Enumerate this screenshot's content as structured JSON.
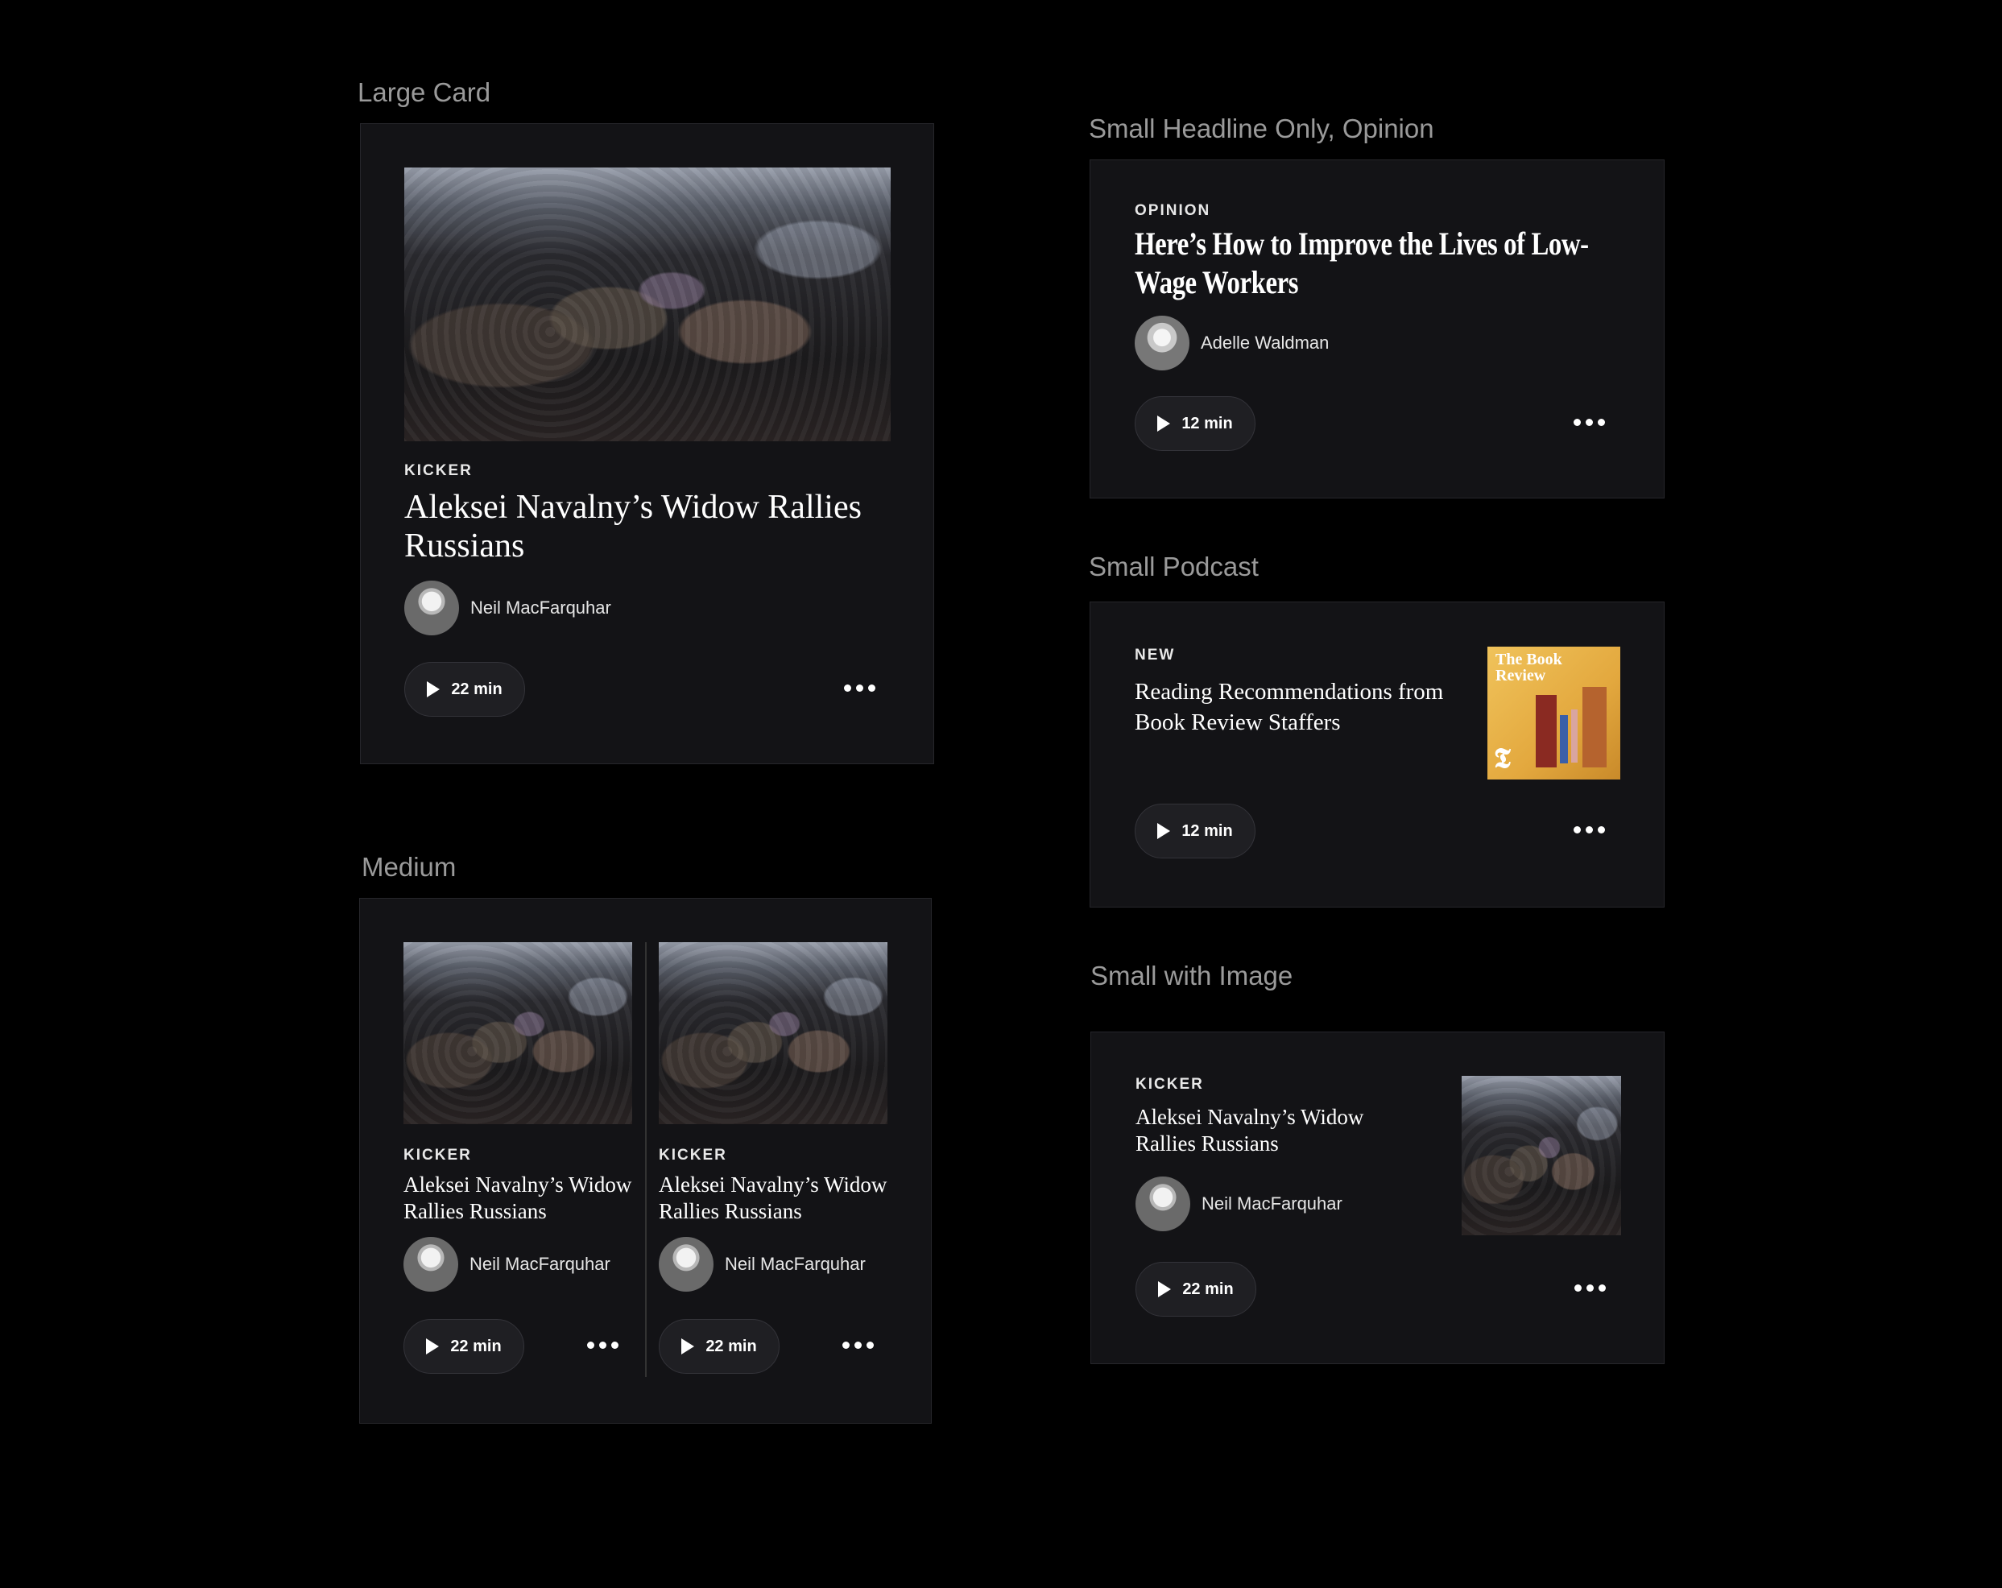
{
  "labels": {
    "large": "Large Card",
    "medium": "Medium",
    "small_headline": "Small Headline Only, Opinion",
    "small_podcast": "Small Podcast",
    "small_image": "Small with Image"
  },
  "large_card": {
    "kicker": "KICKER",
    "headline": "Aleksei Navalny’s Widow Rallies Russians",
    "author": "Neil MacFarquhar",
    "duration": "22 min"
  },
  "medium_cards": [
    {
      "kicker": "KICKER",
      "headline": "Aleksei Navalny’s Widow Rallies Russians",
      "author": "Neil MacFarquhar",
      "duration": "22 min"
    },
    {
      "kicker": "KICKER",
      "headline": "Aleksei Navalny’s Widow Rallies Russians",
      "author": "Neil MacFarquhar",
      "duration": "22 min"
    }
  ],
  "opinion_card": {
    "kicker": "OPINION",
    "headline": "Here’s How to Improve the Lives of Low-Wage Workers",
    "author": "Adelle Waldman",
    "duration": "12 min"
  },
  "podcast_card": {
    "kicker": "NEW",
    "headline": "Reading Recommendations from Book Review Staffers",
    "art_title": "The Book Review",
    "duration": "12 min"
  },
  "image_card": {
    "kicker": "KICKER",
    "headline": "Aleksei Navalny’s Widow Rallies Russians",
    "author": "Neil MacFarquhar",
    "duration": "22 min"
  },
  "colors": {
    "background": "#000000",
    "card": "#131316",
    "button": "#1f1f23",
    "label": "#9a9a9a",
    "podcast_art": "#e3a83e"
  },
  "icons": [
    "play-icon",
    "more-icon"
  ]
}
